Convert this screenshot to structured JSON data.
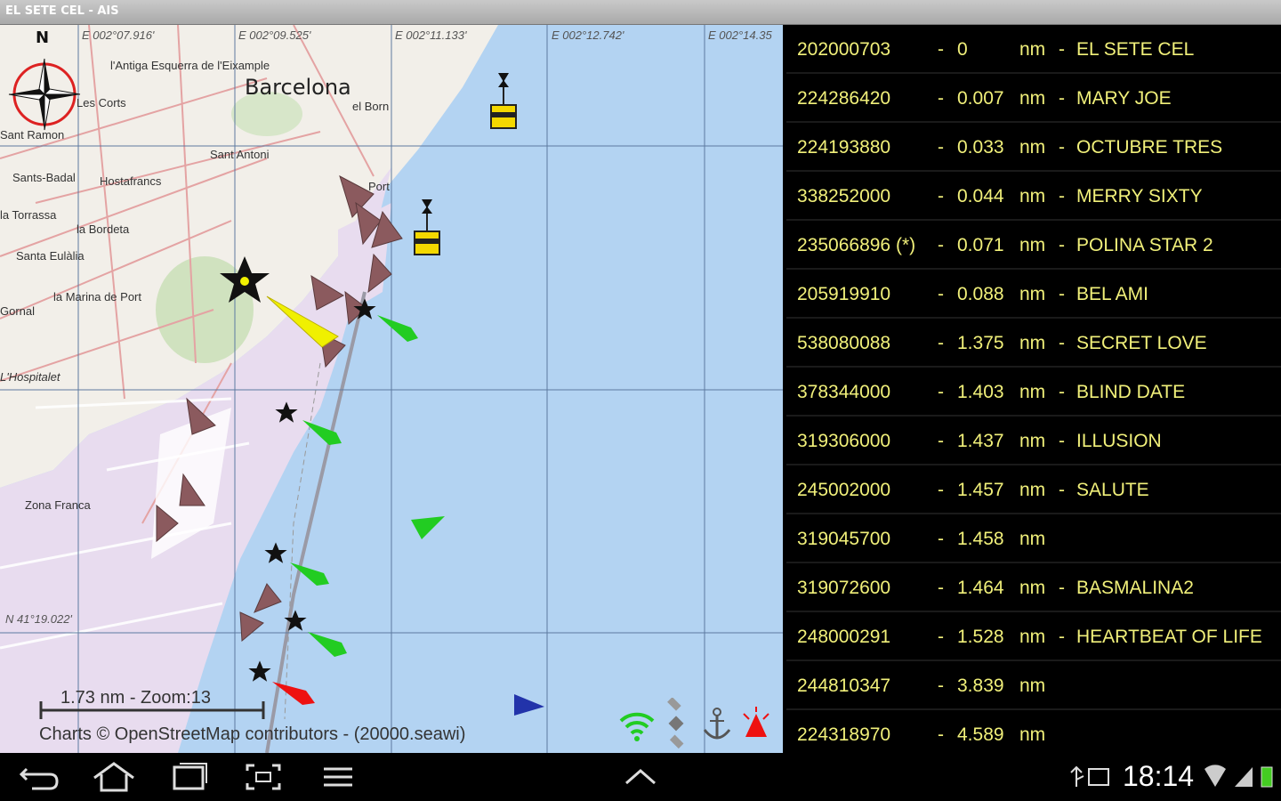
{
  "app": {
    "title": "EL SETE CEL - AIS"
  },
  "map": {
    "north_label": "N",
    "places": [
      "Barcelona",
      "l'Antiga Esquerra de l'Eixample",
      "el Born",
      "Les Corts",
      "Sant Ramon",
      "Sant Antoni",
      "Sants-Badal",
      "Hostafrancs",
      "la Torrassa",
      "la Bordeta",
      "Santa Eulàlia",
      "la Marina de Port",
      "Gornal",
      "L'Hospitalet",
      "Port",
      "Zona Franca"
    ],
    "coords": [
      "E 002°07.916'",
      "E 002°09.525'",
      "E 002°11.133'",
      "E 002°12.742'",
      "E 002°14.35",
      "N 41°19.022'"
    ],
    "scale": "1.73 nm - Zoom:13",
    "credits": "Charts © OpenStreetMap contributors - (20000.seawi)",
    "icons": [
      "wifi-icon",
      "satellite-icon",
      "anchor-icon",
      "alarm-icon"
    ],
    "colors": {
      "water": "#b3d3f2",
      "land": "#f2efe9",
      "port": "#e8dcef",
      "vessel": "#8b5a5e",
      "own_ship": "#f0f000",
      "green": "#22cc22",
      "red": "#ee1111"
    }
  },
  "vessels": [
    {
      "mmsi": "202000703",
      "distance": "0",
      "unit": "nm",
      "name": "EL SETE CEL"
    },
    {
      "mmsi": "224286420",
      "distance": "0.007",
      "unit": "nm",
      "name": "MARY JOE"
    },
    {
      "mmsi": "224193880",
      "distance": "0.033",
      "unit": "nm",
      "name": "OCTUBRE TRES"
    },
    {
      "mmsi": "338252000",
      "distance": "0.044",
      "unit": "nm",
      "name": "MERRY SIXTY"
    },
    {
      "mmsi": "235066896 (*)",
      "distance": "0.071",
      "unit": "nm",
      "name": "POLINA STAR 2"
    },
    {
      "mmsi": "205919910",
      "distance": "0.088",
      "unit": "nm",
      "name": "BEL AMI"
    },
    {
      "mmsi": "538080088",
      "distance": "1.375",
      "unit": "nm",
      "name": "SECRET LOVE"
    },
    {
      "mmsi": "378344000",
      "distance": "1.403",
      "unit": "nm",
      "name": "BLIND DATE"
    },
    {
      "mmsi": "319306000",
      "distance": "1.437",
      "unit": "nm",
      "name": "ILLUSION"
    },
    {
      "mmsi": "245002000",
      "distance": "1.457",
      "unit": "nm",
      "name": "SALUTE"
    },
    {
      "mmsi": "319045700",
      "distance": "1.458",
      "unit": "nm",
      "name": ""
    },
    {
      "mmsi": "319072600",
      "distance": "1.464",
      "unit": "nm",
      "name": "BASMALINA2"
    },
    {
      "mmsi": "248000291",
      "distance": "1.528",
      "unit": "nm",
      "name": "HEARTBEAT OF LIFE"
    },
    {
      "mmsi": "244810347",
      "distance": "3.839",
      "unit": "nm",
      "name": ""
    },
    {
      "mmsi": "224318970",
      "distance": "4.589",
      "unit": "nm",
      "name": ""
    }
  ],
  "statusbar": {
    "time": "18:14"
  }
}
